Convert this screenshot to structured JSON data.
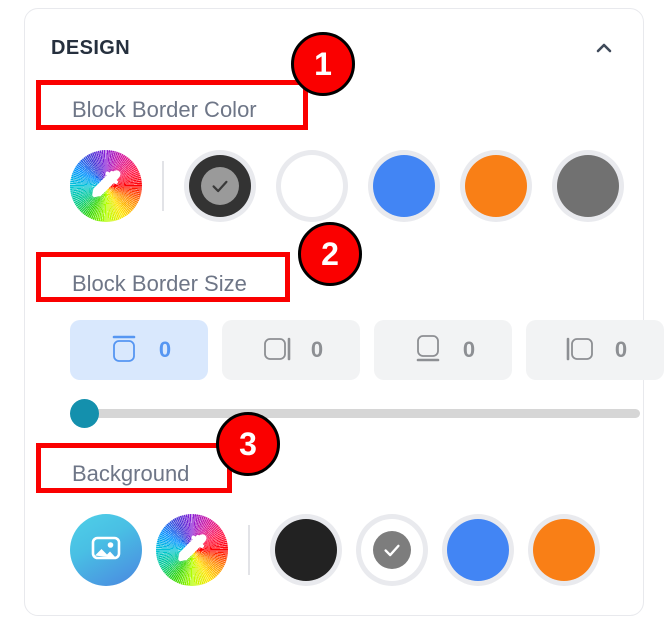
{
  "panel": {
    "title": "DESIGN",
    "collapse_icon": "chevron-up-icon"
  },
  "sections": {
    "border_color": {
      "label": "Block Border Color",
      "swatches": [
        {
          "name": "color-wheel-picker",
          "icon": "color-wheel-eyedropper-icon",
          "type": "wheel",
          "selected": false
        },
        {
          "name": "swatch-dark",
          "color": "#333333",
          "type": "color",
          "selected": true,
          "check_color": "#9a9a9a"
        },
        {
          "name": "swatch-white",
          "color": "#ffffff",
          "type": "color",
          "selected": false
        },
        {
          "name": "swatch-blue",
          "color": "#4285f4",
          "type": "color",
          "selected": false
        },
        {
          "name": "swatch-orange",
          "color": "#f97f16",
          "type": "color",
          "selected": false
        },
        {
          "name": "swatch-gray",
          "color": "#717171",
          "type": "color",
          "selected": false
        }
      ]
    },
    "border_size": {
      "label": "Block Border Size",
      "buttons": [
        {
          "name": "border-top-button",
          "icon": "border-top-icon",
          "value": "0",
          "selected": true
        },
        {
          "name": "border-right-button",
          "icon": "border-right-icon",
          "value": "0",
          "selected": false
        },
        {
          "name": "border-bottom-button",
          "icon": "border-bottom-icon",
          "value": "0",
          "selected": false
        },
        {
          "name": "border-left-button",
          "icon": "border-left-icon",
          "value": "0",
          "selected": false
        }
      ],
      "slider": {
        "value": 0,
        "min": 0,
        "max": 100,
        "thumb_color": "#1490ad",
        "track_color": "#d6d6d6"
      }
    },
    "background": {
      "label": "Background",
      "swatches": [
        {
          "name": "background-image-picker",
          "icon": "image-icon",
          "type": "photo",
          "selected": false
        },
        {
          "name": "color-wheel-picker",
          "icon": "color-wheel-eyedropper-icon",
          "type": "wheel",
          "selected": false
        },
        {
          "name": "swatch-black",
          "color": "#222222",
          "type": "color",
          "selected": false
        },
        {
          "name": "swatch-white",
          "color": "#ffffff",
          "type": "color",
          "selected": true,
          "check_color": "#7d7d7d"
        },
        {
          "name": "swatch-blue",
          "color": "#4285f4",
          "type": "color",
          "selected": false
        },
        {
          "name": "swatch-orange",
          "color": "#f97f16",
          "type": "color",
          "selected": false
        }
      ]
    }
  },
  "annotations": [
    {
      "name": "annotation-badge-1",
      "number": "1",
      "target": "Block Border Color"
    },
    {
      "name": "annotation-badge-2",
      "number": "2",
      "target": "Block Border Size"
    },
    {
      "name": "annotation-badge-3",
      "number": "3",
      "target": "Background"
    }
  ],
  "colors": {
    "annotation_red": "#fa0000",
    "accent_blue": "#5696f2",
    "selected_button_bg": "#d9e8fd",
    "button_bg": "#f2f3f4",
    "label_text": "#6e7687",
    "title_text": "#26303e"
  }
}
